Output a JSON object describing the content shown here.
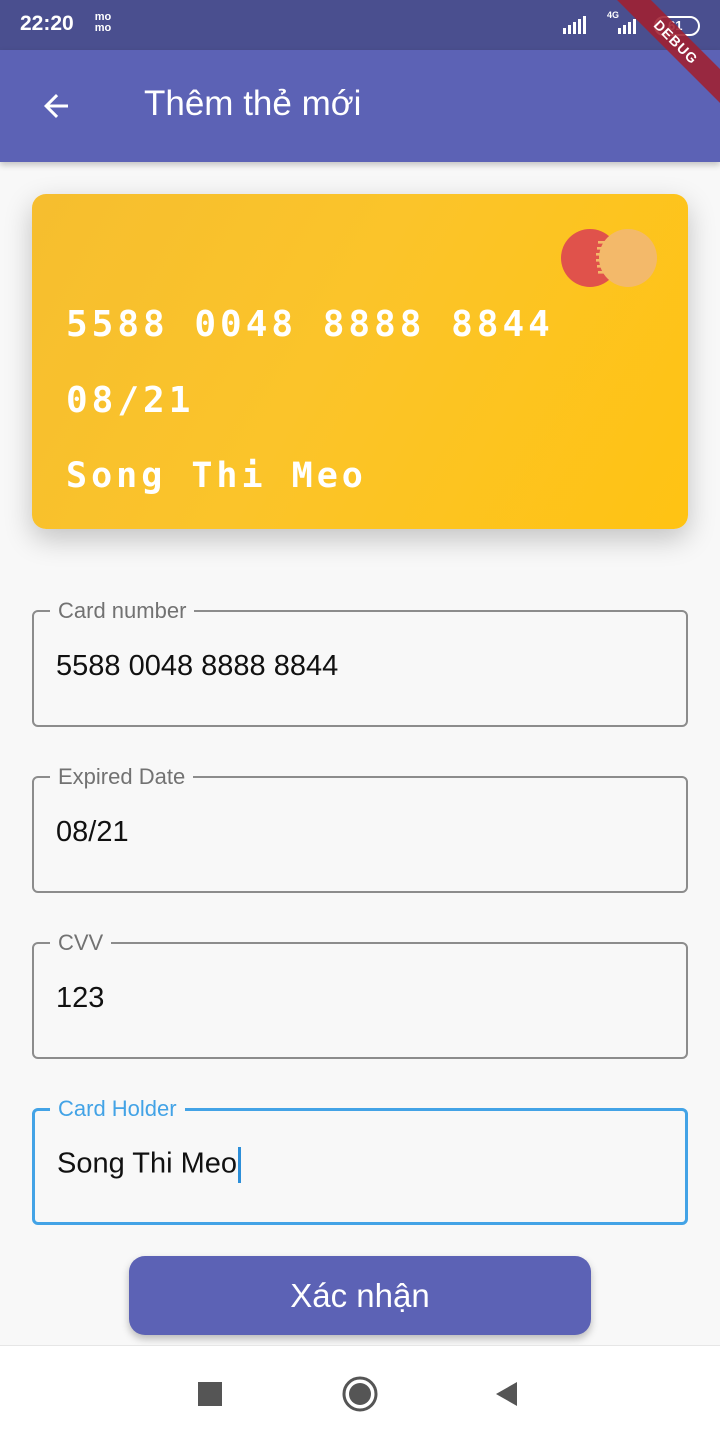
{
  "status_bar": {
    "time": "22:20",
    "momo_top": "mo",
    "momo_bottom": "mo",
    "network": "4G",
    "battery": "61"
  },
  "debug_banner": "DEBUG",
  "app_bar": {
    "title": "Thêm thẻ mới",
    "back_icon": "arrow-back-icon"
  },
  "card_preview": {
    "number": "5588 0048 8888 8844",
    "expiry": "08/21",
    "holder": "Song Thi Meo",
    "brand_icon": "mastercard-logo",
    "color": "#FFC313"
  },
  "form": {
    "card_number": {
      "label": "Card number",
      "value": "5588 0048 8888 8844"
    },
    "expired_date": {
      "label": "Expired Date",
      "value": "08/21"
    },
    "cvv": {
      "label": "CVV",
      "value": "123"
    },
    "card_holder": {
      "label": "Card Holder",
      "value": "Song Thi Meo",
      "focused": true
    }
  },
  "confirm_button": {
    "label": "Xác nhận"
  },
  "colors": {
    "primary": "#5C62B5",
    "focus": "#43A3E6",
    "status_bar": "#4A4F8F"
  },
  "nav": {
    "recents_icon": "square-icon",
    "home_icon": "home-circle-icon",
    "back_icon": "triangle-back-icon"
  }
}
